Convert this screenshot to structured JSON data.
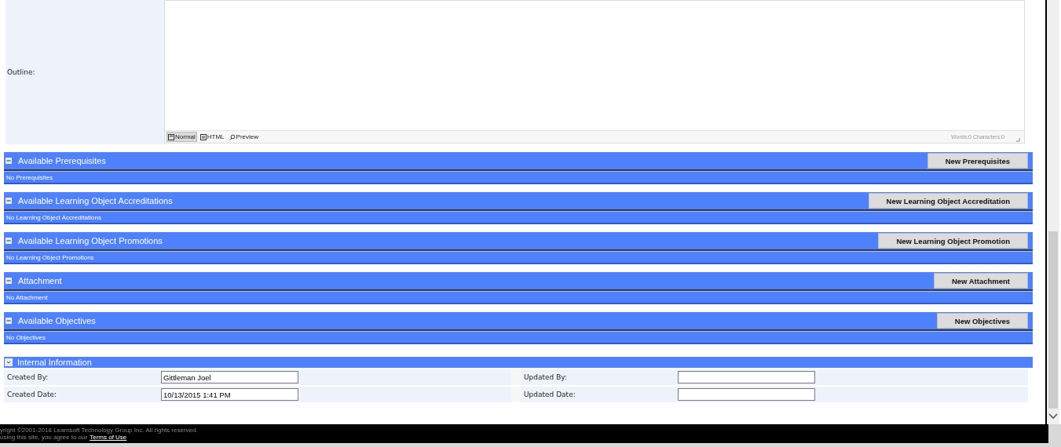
{
  "outline": {
    "label": "Outline:",
    "modes": [
      {
        "label": "Normal",
        "selected": true
      },
      {
        "label": "HTML",
        "selected": false
      },
      {
        "label": "Preview",
        "selected": false
      }
    ],
    "counter": "Words:0 Characters:0"
  },
  "sections": [
    {
      "title": "Available Prerequisites",
      "expanded": true,
      "button": "New Prerequisites",
      "empty": "No Prerequisites"
    },
    {
      "title": "Available Learning Object Accreditations",
      "expanded": true,
      "button": "New Learning Object Accreditation",
      "empty": "No Learning Object Accreditations"
    },
    {
      "title": "Available Learning Object Promotions",
      "expanded": true,
      "button": "New Learning Object Promotion",
      "empty": "No Learning Object Promotions"
    },
    {
      "title": "Attachment",
      "expanded": true,
      "button": "New Attachment",
      "empty": "No Attachment"
    },
    {
      "title": "Available Objectives",
      "expanded": true,
      "button": "New Objectives",
      "empty": "No Objectives"
    }
  ],
  "internal": {
    "title": "Internal Information",
    "rows": [
      [
        {
          "label": "Created By:",
          "value": "Gittleman Joel"
        },
        {
          "label": "Updated By:"
        }
      ],
      [
        {
          "label": "Created Date:",
          "value": "10/13/2015 1:41 PM"
        },
        {
          "label": "Updated Date:"
        }
      ]
    ]
  },
  "footer": {
    "copyright": "yright ©2001-2018 Learnsoft Technology Group Inc. All rights reserved.",
    "notice": "using this site, you agree to our",
    "link": "Terms of Use"
  }
}
